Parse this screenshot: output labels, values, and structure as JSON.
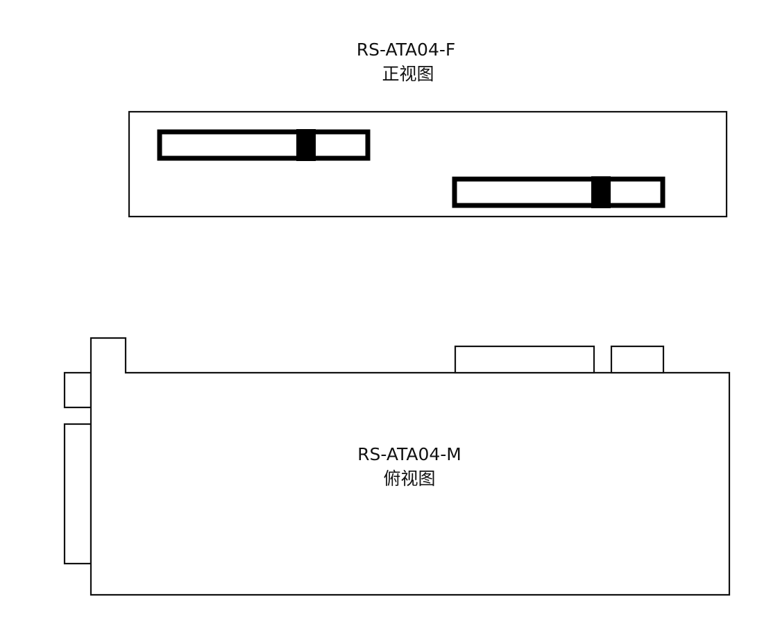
{
  "front_view": {
    "model": "RS-ATA04-F",
    "view_name": "正视图"
  },
  "top_view": {
    "model": "RS-ATA04-M",
    "view_name": "俯视图"
  },
  "colors": {
    "line": "#111111",
    "background": "#ffffff",
    "latch_fill": "#000000"
  }
}
